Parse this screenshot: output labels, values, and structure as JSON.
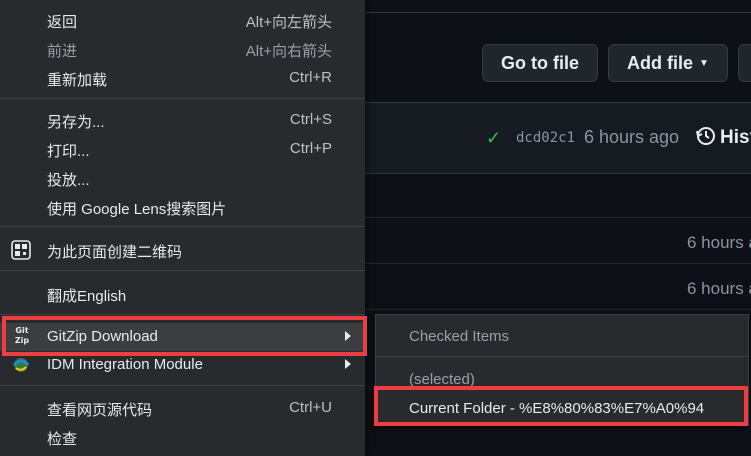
{
  "github": {
    "go_to_file": "Go to file",
    "add_file": "Add file",
    "commit_hash": "dcd02c1",
    "commit_time": "6 hours ago",
    "history_label": "Hist",
    "row_times": [
      "6 hours a",
      "6 hours a"
    ]
  },
  "context_menu": {
    "back": {
      "label": "返回",
      "shortcut": "Alt+向左箭头"
    },
    "forward": {
      "label": "前进",
      "shortcut": "Alt+向右箭头"
    },
    "reload": {
      "label": "重新加载",
      "shortcut": "Ctrl+R"
    },
    "save_as": {
      "label": "另存为...",
      "shortcut": "Ctrl+S"
    },
    "print": {
      "label": "打印...",
      "shortcut": "Ctrl+P"
    },
    "cast": {
      "label": "投放..."
    },
    "google_lens": {
      "label": "使用 Google Lens搜索图片"
    },
    "qr_code": {
      "label": "为此页面创建二维码"
    },
    "translate": {
      "label": "翻成English"
    },
    "gitzip": {
      "label": "GitZip Download",
      "icon_text": [
        "Git",
        "Zip"
      ]
    },
    "idm": {
      "label": "IDM Integration Module"
    },
    "view_source": {
      "label": "查看网页源代码",
      "shortcut": "Ctrl+U"
    },
    "inspect": {
      "label": "检查"
    }
  },
  "submenu": {
    "checked_items": "Checked Items",
    "selected": "(selected)",
    "current_folder": "Current Folder - %E8%80%83%E7%A0%94"
  },
  "colors": {
    "highlight_border": "#ef3e42",
    "menu_bg": "#292a2d",
    "check_green": "#3fb950"
  }
}
